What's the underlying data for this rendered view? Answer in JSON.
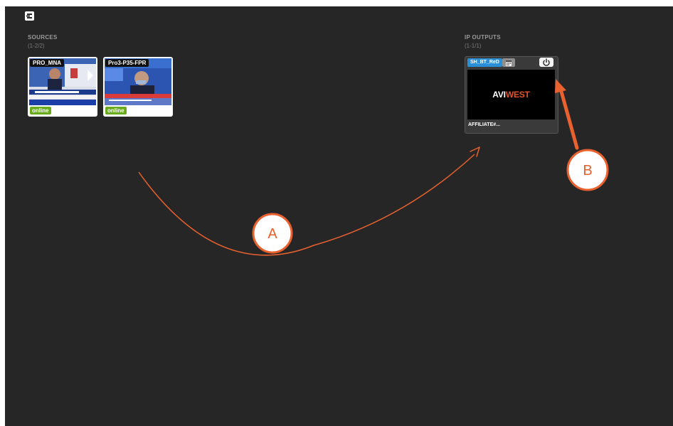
{
  "sources": {
    "title": "SOURCES",
    "count": "(1-2/2)",
    "items": [
      {
        "name": "PRO_MNA",
        "status": "online"
      },
      {
        "name": "Pro3-P35-FPR",
        "status": "online"
      }
    ]
  },
  "outputs": {
    "title": "IP OUTPUTS",
    "count": "(1-1/1)",
    "items": [
      {
        "tag": "SH_BT_ReD",
        "name": "AFFILIATE#...",
        "brand_a": "AVI",
        "brand_b": "WEST"
      }
    ]
  },
  "annotations": {
    "a": "A",
    "b": "B"
  },
  "colors": {
    "background": "#262626",
    "online": "#6aaa1f",
    "tag": "#2a8fd6",
    "annotation": "#e8612e"
  },
  "icons": {
    "exit": "exit-panel-icon",
    "schedule": "calendar-icon",
    "power": "power-icon"
  }
}
